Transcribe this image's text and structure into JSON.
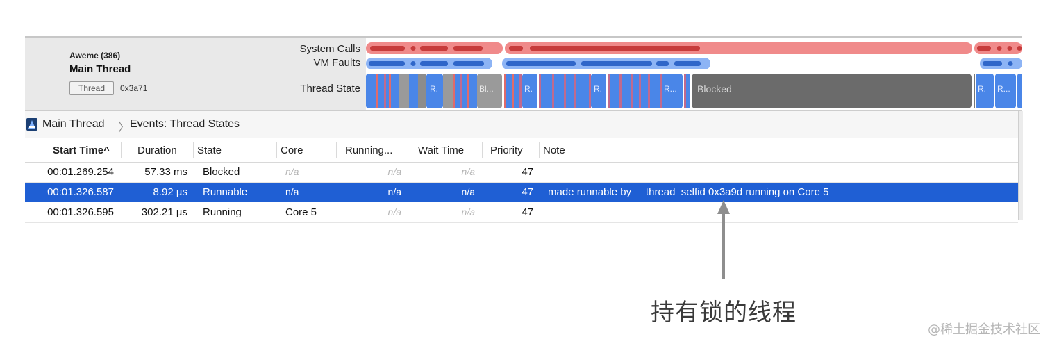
{
  "process": {
    "name": "Aweme (386)"
  },
  "thread": {
    "title": "Main Thread",
    "tag": "Thread",
    "id": "0x3a71"
  },
  "tracks": {
    "system_calls": "System Calls",
    "vm_faults": "VM Faults",
    "thread_state": "Thread State",
    "blocked_label": "Blocked",
    "runnable_short": "R.",
    "runnable_short_2": "R...",
    "blocked_short": "Bl..."
  },
  "breadcrumb": {
    "root": "Main Thread",
    "separator": "〉",
    "current": "Events: Thread States"
  },
  "table": {
    "columns": [
      "Start Time^",
      "Duration",
      "State",
      "Core",
      "Running...",
      "Wait Time",
      "Priority",
      "Note"
    ],
    "rows": [
      {
        "start": "00:01.269.254",
        "duration": "57.33 ms",
        "state": "Blocked",
        "core": "n/a",
        "running": "n/a",
        "wait": "n/a",
        "priority": "47",
        "note": ""
      },
      {
        "start": "00:01.326.587",
        "duration": "8.92 µs",
        "state": "Runnable",
        "core": "n/a",
        "running": "n/a",
        "wait": "n/a",
        "priority": "47",
        "note": "made runnable by __thread_selfid  0x3a9d running on Core 5"
      },
      {
        "start": "00:01.326.595",
        "duration": "302.21 µs",
        "state": "Running",
        "core": "Core 5",
        "running": "n/a",
        "wait": "n/a",
        "priority": "47",
        "note": ""
      }
    ]
  },
  "annotation": "持有锁的线程",
  "watermark": "@稀土掘金技术社区",
  "colors": {
    "selection": "#1f5fd4",
    "syscall_light": "#f08a8a",
    "syscall_dark": "#c73b3b",
    "vm_fault": "#3f7de0",
    "blocked": "#6b6b6b",
    "runnable": "#4a86e8"
  }
}
